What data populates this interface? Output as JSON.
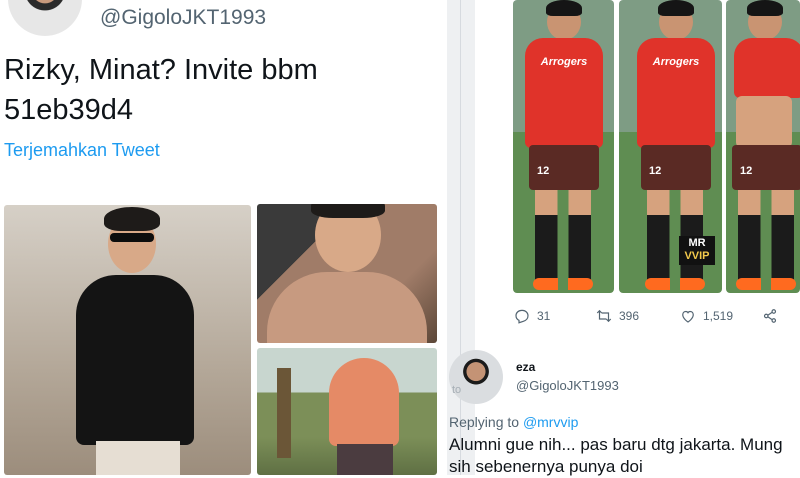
{
  "left_tweet": {
    "handle": "@GigoloJKT1993",
    "text_line1": "Rizky, Minat? Invite bbm",
    "text_line2": "51eb39d4",
    "translate_label": "Terjemahkan Tweet"
  },
  "right_tweet": {
    "watermark_line1": "MR",
    "watermark_line2": "VVIP",
    "jersey_text": "Arrogers",
    "shorts_number": "12",
    "actions": {
      "replies": "31",
      "retweets": "396",
      "likes": "1,519"
    }
  },
  "reply": {
    "name": "eza",
    "handle": "@GigoloJKT1993",
    "replying_prefix": "Replying to",
    "replying_to": "@mrvvip",
    "text_line1": "Alumni gue nih... pas baru dtg jakarta. Mung",
    "text_line2": "sih sebenernya punya doi",
    "ghost_label": "to"
  },
  "colors": {
    "link": "#1d9bf0",
    "text": "#0f1419",
    "muted": "#536471",
    "jersey": "#e0332a"
  }
}
